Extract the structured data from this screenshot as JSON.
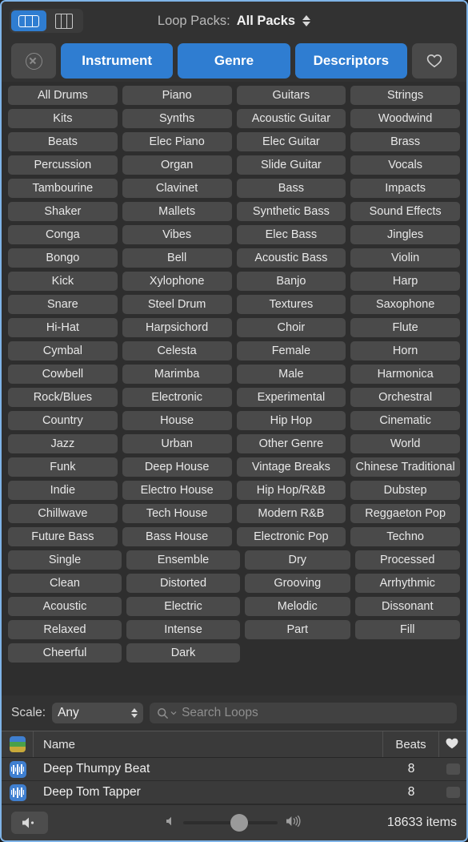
{
  "window": {
    "accent_blue": "#2f7dd1",
    "panel_bg": "#2e2e2e",
    "chrome_bg": "#323232"
  },
  "topbar": {
    "view_toggle": {
      "list_view_label": "list-view",
      "column_view_label": "column-view",
      "active": "list-view"
    },
    "loop_packs": {
      "label": "Loop Packs:",
      "value": "All Packs"
    }
  },
  "filterbar": {
    "reset_label": "",
    "buttons": [
      {
        "label": "Instrument",
        "active": true
      },
      {
        "label": "Genre",
        "active": true
      },
      {
        "label": "Descriptors",
        "active": true
      }
    ],
    "favorites_label": ""
  },
  "tag_grid": {
    "instrument_genre_rows": [
      [
        "All Drums",
        "Piano",
        "Guitars",
        "Strings"
      ],
      [
        "Kits",
        "Synths",
        "Acoustic Guitar",
        "Woodwind"
      ],
      [
        "Beats",
        "Elec Piano",
        "Elec Guitar",
        "Brass"
      ],
      [
        "Percussion",
        "Organ",
        "Slide Guitar",
        "Vocals"
      ],
      [
        "Tambourine",
        "Clavinet",
        "Bass",
        "Impacts"
      ],
      [
        "Shaker",
        "Mallets",
        "Synthetic Bass",
        "Sound Effects"
      ],
      [
        "Conga",
        "Vibes",
        "Elec Bass",
        "Jingles"
      ],
      [
        "Bongo",
        "Bell",
        "Acoustic Bass",
        "Violin"
      ],
      [
        "Kick",
        "Xylophone",
        "Banjo",
        "Harp"
      ],
      [
        "Snare",
        "Steel Drum",
        "Textures",
        "Saxophone"
      ],
      [
        "Hi-Hat",
        "Harpsichord",
        "Choir",
        "Flute"
      ],
      [
        "Cymbal",
        "Celesta",
        "Female",
        "Horn"
      ],
      [
        "Cowbell",
        "Marimba",
        "Male",
        "Harmonica"
      ],
      [
        "Rock/Blues",
        "Electronic",
        "Experimental",
        "Orchestral"
      ],
      [
        "Country",
        "House",
        "Hip Hop",
        "Cinematic"
      ],
      [
        "Jazz",
        "Urban",
        "Other Genre",
        "World"
      ],
      [
        "Funk",
        "Deep House",
        "Vintage Breaks",
        "Chinese Traditional"
      ],
      [
        "Indie",
        "Electro House",
        "Hip Hop/R&B",
        "Dubstep"
      ],
      [
        "Chillwave",
        "Tech House",
        "Modern R&B",
        "Reggaeton Pop"
      ],
      [
        "Future Bass",
        "Bass House",
        "Electronic Pop",
        "Techno"
      ]
    ],
    "descriptor_rows": [
      [
        "Single",
        "Ensemble",
        "Dry",
        "Processed"
      ],
      [
        "Clean",
        "Distorted",
        "Grooving",
        "Arrhythmic"
      ],
      [
        "Acoustic",
        "Electric",
        "Melodic",
        "Dissonant"
      ],
      [
        "Relaxed",
        "Intense",
        "Part",
        "Fill"
      ],
      [
        "Cheerful",
        "Dark",
        "",
        ""
      ]
    ]
  },
  "searchbar": {
    "scale_label": "Scale:",
    "scale_value": "Any",
    "search_placeholder": "Search Loops"
  },
  "results": {
    "columns": {
      "kind": "",
      "name": "Name",
      "beats": "Beats",
      "favorite": ""
    },
    "rows": [
      {
        "name": "Deep Thumpy Beat",
        "beats": "8"
      },
      {
        "name": "Deep Tom Tapper",
        "beats": "8"
      }
    ]
  },
  "footer": {
    "mute_label": "",
    "items_count": "18633 items"
  }
}
